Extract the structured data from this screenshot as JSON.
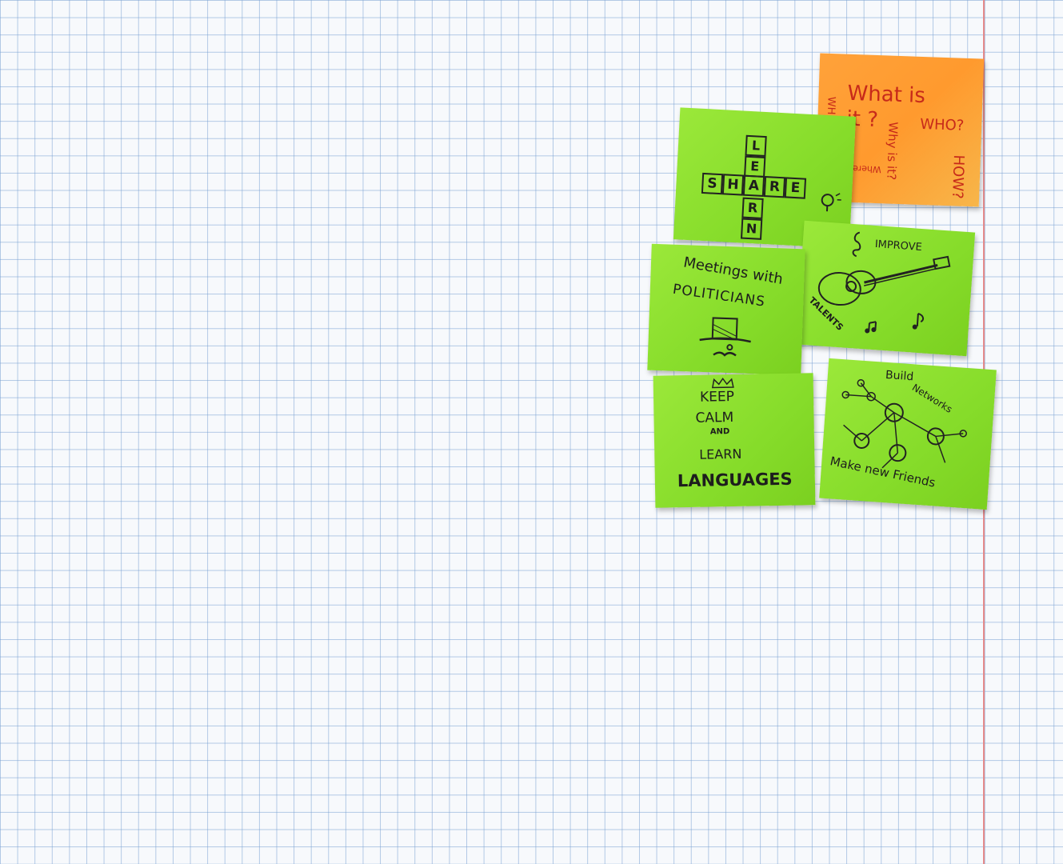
{
  "notes": {
    "questions": {
      "what": "What is",
      "it": "it ?",
      "who": "WHO?",
      "how": "HOW?",
      "why": "Why is it?",
      "where": "Where?",
      "when": "WHEN?"
    },
    "crossword": {
      "share": [
        "S",
        "H",
        "A",
        "R",
        "E"
      ],
      "learn": [
        "L",
        "E",
        "A",
        "R",
        "N"
      ]
    },
    "talents": {
      "improve": "IMPROVE",
      "talents": "TALENTS"
    },
    "politicians": {
      "line1": "Meetings with",
      "line2": "POLITICIANS"
    },
    "languages": {
      "keep": "KEEP",
      "calm": "CALM",
      "and": "AND",
      "learn": "LEARN",
      "languages": "LANGUAGES"
    },
    "networks": {
      "build": "Build",
      "networks": "Networks",
      "friends": "Make new Friends"
    }
  }
}
